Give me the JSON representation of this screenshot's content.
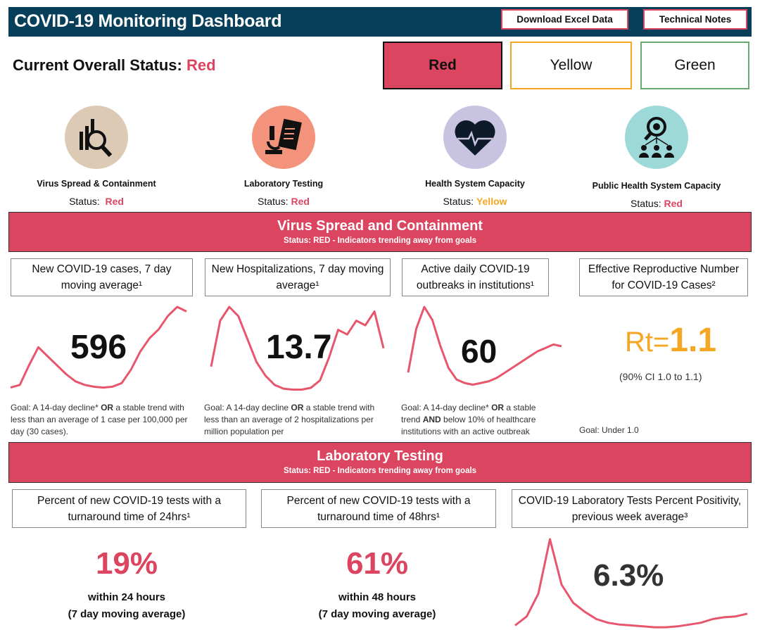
{
  "header": {
    "title": "COVID-19 Monitoring Dashboard",
    "download_label": "Download Excel Data",
    "notes_label": "Technical Notes",
    "bg_color": "#073f5a"
  },
  "overall": {
    "label": "Current Overall Status:",
    "value": "Red"
  },
  "status_options": [
    {
      "label": "Red",
      "color": "#dc4560",
      "selected": true
    },
    {
      "label": "Yellow",
      "color": "#f5a623",
      "selected": false
    },
    {
      "label": "Green",
      "color": "#6aaa6e",
      "selected": false
    }
  ],
  "categories": [
    {
      "label": "Virus Spread & Containment",
      "status_label": "Status:",
      "status": "Red",
      "icon": "chart-magnifier-icon",
      "color": "#dccab5"
    },
    {
      "label": "Laboratory Testing",
      "status_label": "Status:",
      "status": "Red",
      "icon": "microscope-clipboard-icon",
      "color": "#f4937c"
    },
    {
      "label": "Health System Capacity",
      "status_label": "Status:",
      "status": "Yellow",
      "icon": "heart-pulse-icon",
      "color": "#c7c3e0"
    },
    {
      "label": "Public Health System Capacity",
      "status_label": "Status:",
      "status": "Red",
      "icon": "virus-people-icon",
      "color": "#9ed9d9"
    }
  ],
  "virus_section": {
    "title": "Virus Spread and Containment",
    "subtitle": "Status: RED - Indicators trending away from goals",
    "metrics": [
      {
        "title": "New COVID-19 cases, 7 day moving average¹",
        "value": "596",
        "goal_html": "Goal: A 14-day decline* <b>OR</b> a stable trend with less than an average of 1 case per 100,000 per day (30 cases).",
        "trend": [
          5,
          8,
          30,
          50,
          40,
          30,
          20,
          12,
          8,
          6,
          5,
          6,
          10,
          25,
          45,
          60,
          70,
          85,
          95,
          90
        ]
      },
      {
        "title": "New Hospitalizations, 7 day moving average¹",
        "value": "13.7",
        "goal_html": "Goal: A 14-day decline <b>OR</b> a stable trend with less than an average of 2 hospitalizations per million population per",
        "trend": [
          30,
          80,
          95,
          85,
          60,
          35,
          20,
          10,
          6,
          5,
          5,
          7,
          15,
          40,
          70,
          65,
          80,
          75,
          90,
          50
        ]
      },
      {
        "title": "Active daily COVID-19 outbreaks in institutions¹",
        "value": "60",
        "goal_html": "Goal: A 14-day decline* <b>OR</b> a stable trend <b>AND</b> below 10% of healthcare institutions with an active outbreak",
        "trend": [
          20,
          70,
          95,
          80,
          50,
          25,
          12,
          8,
          6,
          8,
          10,
          14,
          20,
          26,
          32,
          38,
          44,
          48,
          52,
          50
        ]
      },
      {
        "title": "Effective Reproductive Number for COVID-19 Cases²",
        "rt_symbol": "Rt=",
        "value": "1.1",
        "ci": "(90% CI 1.0 to 1.1)",
        "goal_html": "Goal: Under 1.0"
      }
    ]
  },
  "lab_section": {
    "title": "Laboratory Testing",
    "subtitle": "Status: RED - Indicators trending away from goals",
    "metrics": [
      {
        "title": "Percent of new COVID-19 tests with a turnaround time of 24hrs¹",
        "value": "19%",
        "sub1": "within 24 hours",
        "sub2": "(7 day moving average)"
      },
      {
        "title": "Percent of new COVID-19 tests with a turnaround time of 48hrs¹",
        "value": "61%",
        "sub1": "within 48 hours",
        "sub2": "(7 day moving average)"
      },
      {
        "title": "COVID-19 Laboratory Tests Percent Positivity, previous week average³",
        "value": "6.3%",
        "trend": [
          5,
          15,
          40,
          100,
          50,
          30,
          20,
          12,
          8,
          6,
          5,
          4,
          3,
          3,
          4,
          6,
          8,
          12,
          14,
          15,
          18
        ]
      }
    ]
  }
}
